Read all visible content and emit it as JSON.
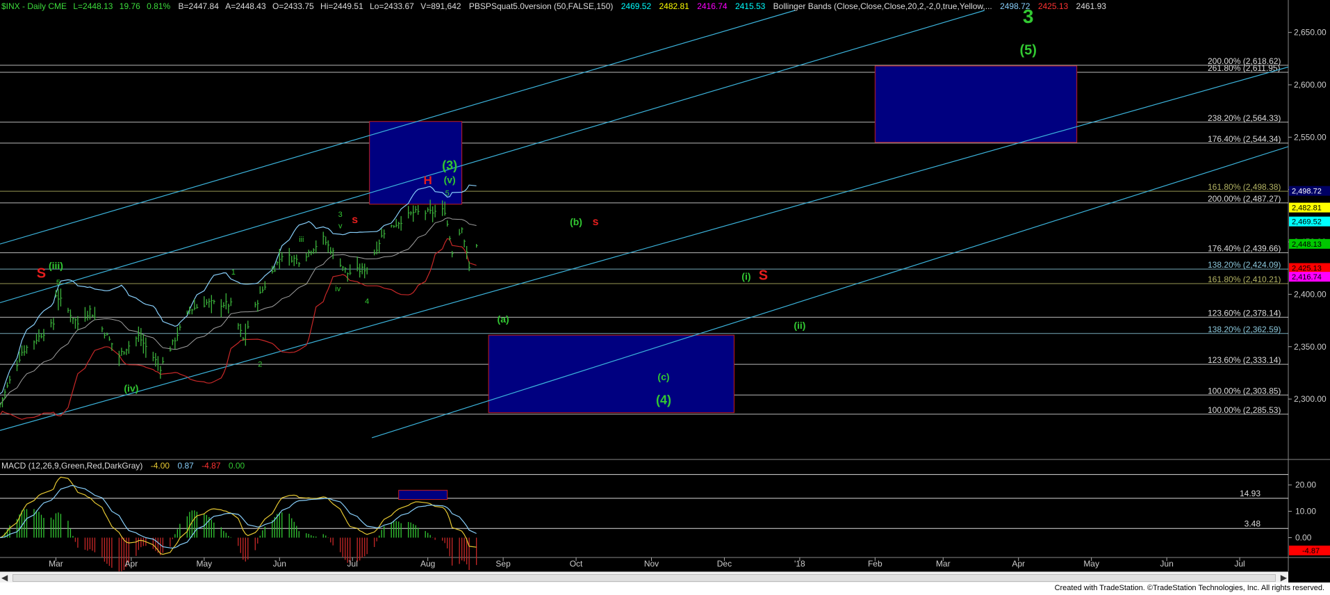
{
  "header": {
    "symbol": "$INX - Daily  CME",
    "last": "L=2448.13",
    "change": "19.76",
    "change_pct": "0.81%",
    "bid": "B=2447.84",
    "ask": "A=2448.43",
    "open": "O=2433.75",
    "high": "Hi=2449.51",
    "low": "Lo=2433.67",
    "volume": "V=891,642",
    "indicator": "PBSPSquat5.0version (50,FALSE,150)",
    "ind_v1": "2469.52",
    "ind_v2": "2482.81",
    "ind_v3": "2416.74",
    "ind_v4": "2415.53",
    "bb_label": "Bollinger Bands (Close,Close,Close,20,2,-2,0,true,Yellow,...",
    "bb_v1": "2498.72",
    "bb_v2": "2425.13",
    "bb_v3": "2461.93"
  },
  "macd_header": {
    "label": "MACD (12,26,9,Green,Red,DarkGray)",
    "v1": "-4.00",
    "v2": "0.87",
    "v3": "-4.87",
    "v4": "0.00"
  },
  "footer": "Created with TradeStation. ©TradeStation Technologies, Inc. All rights reserved.",
  "colors": {
    "background": "#000000",
    "bar": "#3cb43c",
    "bb_upper": "#87cefa",
    "bb_lower": "#c82828",
    "bb_mid": "#a0a0a0",
    "channel": "#3cb4dc",
    "box_fill": "#000080",
    "box_border": "#c81e1e",
    "wave_green": "#32c832",
    "wave_red": "#e61e1e",
    "fib_gray": "#dcdcdc",
    "fib_olive": "#b4b464",
    "fib_cyan": "#8cc8dc",
    "macd_line": "#e6c832",
    "macd_signal": "#87cefa",
    "hist_green": "#32c832",
    "hist_red": "#c82828"
  },
  "chart_data": {
    "type": "candlestick",
    "price_axis": {
      "ylim": [
        2243,
        2671
      ],
      "ticks": [
        "2,650.00",
        "2,600.00",
        "2,550.00",
        "2,500.00",
        "2,450.00",
        "2,400.00",
        "2,350.00",
        "2,300.00"
      ],
      "tick_values": [
        2650,
        2600,
        2550,
        2500,
        2450,
        2400,
        2350,
        2300
      ]
    },
    "time_axis": {
      "labels": [
        "Mar",
        "Apr",
        "May",
        "Jun",
        "Jul",
        "Aug",
        "Sep",
        "Oct",
        "Nov",
        "Dec",
        "'18",
        "Feb",
        "Mar",
        "Apr",
        "May",
        "Jun",
        "Jul"
      ],
      "label_dates": [
        "2017-03-01",
        "2017-04-01",
        "2017-05-01",
        "2017-06-01",
        "2017-07-01",
        "2017-08-01",
        "2017-09-01",
        "2017-10-01",
        "2017-11-01",
        "2017-12-01",
        "2018-01-01",
        "2018-02-01",
        "2018-03-01",
        "2018-04-01",
        "2018-05-01",
        "2018-06-01",
        "2018-07-01"
      ],
      "start_date": "2017-02-06",
      "end_date": "2018-07-21",
      "last_bar_date": "2017-08-21"
    },
    "last_price_tags": [
      {
        "value": 2498.72,
        "label": "2,498.72",
        "color": "#000064",
        "text": "#fff"
      },
      {
        "value": 2482.81,
        "label": "2,482.81",
        "color": "#ffff00",
        "text": "#000"
      },
      {
        "value": 2469.52,
        "label": "2,469.52",
        "color": "#00ffff",
        "text": "#000"
      },
      {
        "value": 2448.13,
        "label": "2,448.13",
        "color": "#00c800",
        "text": "#000"
      },
      {
        "value": 2425.13,
        "label": "2,425.13",
        "color": "#ff0000",
        "text": "#000"
      },
      {
        "value": 2416.74,
        "label": "2,416.74",
        "color": "#ff00ff",
        "text": "#000"
      }
    ],
    "fib_lines": [
      {
        "value": 2618.62,
        "label": "200.00% (2,618.62)",
        "color": "#dcdcdc",
        "line": "2017-02-06"
      },
      {
        "value": 2611.95,
        "label": "261.80% (2,611.95)",
        "color": "#dcdcdc",
        "line": "2017-02-06"
      },
      {
        "value": 2564.33,
        "label": "238.20% (2,564.33)",
        "color": "#dcdcdc",
        "line": "2017-02-06"
      },
      {
        "value": 2544.34,
        "label": "176.40% (2,544.34)",
        "color": "#dcdcdc",
        "line": "2017-02-06"
      },
      {
        "value": 2498.38,
        "label": "161.80% (2,498.38)",
        "color": "#b4b464",
        "line": "2017-02-06"
      },
      {
        "value": 2487.27,
        "label": "200.00% (2,487.27)",
        "color": "#dcdcdc",
        "line": "2017-02-06"
      },
      {
        "value": 2439.66,
        "label": "176.40% (2,439.66)",
        "color": "#dcdcdc",
        "line": "2017-02-06"
      },
      {
        "value": 2424.09,
        "label": "138.20% (2,424.09)",
        "color": "#8cc8dc",
        "line": "2017-02-06"
      },
      {
        "value": 2410.21,
        "label": "161.80% (2,410.21)",
        "color": "#b4b464",
        "line": "2017-02-06"
      },
      {
        "value": 2378.14,
        "label": "123.60% (2,378.14)",
        "color": "#dcdcdc",
        "line": "2017-02-06"
      },
      {
        "value": 2362.59,
        "label": "138.20% (2,362.59)",
        "color": "#8cc8dc",
        "line": "2017-02-06"
      },
      {
        "value": 2333.14,
        "label": "123.60% (2,333.14)",
        "color": "#dcdcdc",
        "line": "2017-02-06"
      },
      {
        "value": 2303.85,
        "label": "100.00% (2,303.85)",
        "color": "#dcdcdc",
        "line": "2017-02-06"
      },
      {
        "value": 2285.53,
        "label": "100.00% (2,285.53)",
        "color": "#dcdcdc",
        "line": "2017-02-06"
      }
    ],
    "target_boxes": [
      {
        "date_start": "2017-07-08",
        "date_end": "2017-08-15",
        "top": 2565,
        "bottom": 2486
      },
      {
        "date_start": "2017-08-26",
        "date_end": "2017-12-05",
        "top": 2361,
        "bottom": 2287
      },
      {
        "date_start": "2018-02-01",
        "date_end": "2018-04-25",
        "top": 2618,
        "bottom": 2545
      }
    ],
    "channel_lines": [
      {
        "from": [
          "2017-02-06",
          2448
        ],
        "to": [
          "2017-12-30",
          2671
        ]
      },
      {
        "from": [
          "2017-02-06",
          2392
        ],
        "to": [
          "2018-03-18",
          2671
        ]
      },
      {
        "from": [
          "2017-02-06",
          2270
        ],
        "to": [
          "2018-07-21",
          2617
        ]
      },
      {
        "from": [
          "2017-07-09",
          2263
        ],
        "to": [
          "2018-07-21",
          2541
        ]
      }
    ],
    "candles": [],
    "bollinger": {
      "upper": [],
      "middle": [],
      "lower": []
    },
    "wave_labels": [
      {
        "text": "3",
        "date": "2018-04-05",
        "value": 2659,
        "color": "#32c832",
        "size": 28,
        "bold": true
      },
      {
        "text": "(5)",
        "date": "2018-04-05",
        "value": 2629,
        "color": "#32c832",
        "size": 20,
        "bold": true
      },
      {
        "text": "(3)",
        "date": "2017-08-10",
        "value": 2519,
        "color": "#32c832",
        "size": 18,
        "bold": true
      },
      {
        "text": "(v)",
        "date": "2017-08-10",
        "value": 2506,
        "color": "#32c832",
        "size": 14,
        "bold": true
      },
      {
        "text": "H",
        "date": "2017-08-01",
        "value": 2505,
        "color": "#e61e1e",
        "size": 17,
        "bold": true
      },
      {
        "text": "5",
        "date": "2017-08-09",
        "value": 2494,
        "color": "#32c832",
        "size": 11,
        "bold": false
      },
      {
        "text": "(b)",
        "date": "2017-10-01",
        "value": 2466,
        "color": "#32c832",
        "size": 14,
        "bold": true
      },
      {
        "text": "s",
        "date": "2017-10-09",
        "value": 2466,
        "color": "#e61e1e",
        "size": 16,
        "bold": true
      },
      {
        "text": "3",
        "date": "2017-06-26",
        "value": 2474,
        "color": "#32c832",
        "size": 11,
        "bold": false
      },
      {
        "text": "v",
        "date": "2017-06-26",
        "value": 2463,
        "color": "#32c832",
        "size": 11,
        "bold": false
      },
      {
        "text": "s",
        "date": "2017-07-02",
        "value": 2468,
        "color": "#e61e1e",
        "size": 16,
        "bold": true
      },
      {
        "text": "iii",
        "date": "2017-06-10",
        "value": 2450,
        "color": "#32c832",
        "size": 11,
        "bold": false
      },
      {
        "text": "1",
        "date": "2017-05-13",
        "value": 2419,
        "color": "#32c832",
        "size": 11,
        "bold": false
      },
      {
        "text": "iv",
        "date": "2017-06-25",
        "value": 2403,
        "color": "#32c832",
        "size": 11,
        "bold": false
      },
      {
        "text": "4",
        "date": "2017-07-07",
        "value": 2391,
        "color": "#32c832",
        "size": 11,
        "bold": false
      },
      {
        "text": "2",
        "date": "2017-05-24",
        "value": 2331,
        "color": "#32c832",
        "size": 11,
        "bold": false
      },
      {
        "text": "S",
        "date": "2017-02-23",
        "value": 2416,
        "color": "#e61e1e",
        "size": 20,
        "bold": true
      },
      {
        "text": "(iii)",
        "date": "2017-03-01",
        "value": 2424,
        "color": "#32c832",
        "size": 14,
        "bold": true
      },
      {
        "text": "5",
        "date": "2017-03-02",
        "value": 2409,
        "color": "#32c832",
        "size": 11,
        "bold": false
      },
      {
        "text": "(iv)",
        "date": "2017-04-01",
        "value": 2307,
        "color": "#32c832",
        "size": 14,
        "bold": true
      },
      {
        "text": "(i)",
        "date": "2017-12-10",
        "value": 2414,
        "color": "#32c832",
        "size": 14,
        "bold": true
      },
      {
        "text": "S",
        "date": "2017-12-17",
        "value": 2414,
        "color": "#e61e1e",
        "size": 20,
        "bold": true
      },
      {
        "text": "(a)",
        "date": "2017-09-01",
        "value": 2373,
        "color": "#32c832",
        "size": 14,
        "bold": true
      },
      {
        "text": "(ii)",
        "date": "2018-01-01",
        "value": 2367,
        "color": "#32c832",
        "size": 14,
        "bold": true
      },
      {
        "text": "(c)",
        "date": "2017-11-06",
        "value": 2318,
        "color": "#32c832",
        "size": 14,
        "bold": true
      },
      {
        "text": "(4)",
        "date": "2017-11-06",
        "value": 2295,
        "color": "#32c832",
        "size": 18,
        "bold": true
      }
    ],
    "macd": {
      "ylim": [
        -7,
        26
      ],
      "ticks": [
        "20.00",
        "10.00",
        "0.00"
      ],
      "tick_values": [
        20,
        10,
        0
      ],
      "level_lines": [
        {
          "value": 14.93,
          "label": "14.93"
        },
        {
          "value": 3.48,
          "label": "3.48"
        }
      ],
      "last_tag": {
        "value": -4.87,
        "label": "-4.87"
      },
      "box": {
        "date_start": "2017-07-20",
        "date_end": "2017-08-09",
        "top": 18,
        "bottom": 14.5
      },
      "macd_line": [],
      "signal_line": [],
      "histogram": []
    }
  }
}
